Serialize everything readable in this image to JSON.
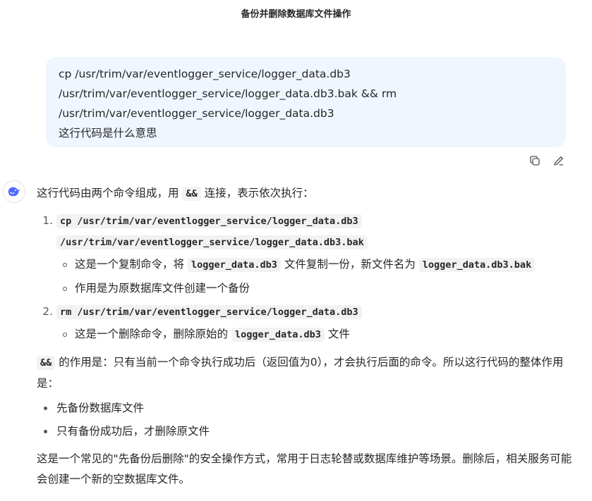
{
  "title": "备份并删除数据库文件操作",
  "user_message": {
    "lines": [
      "cp /usr/trim/var/eventlogger_service/logger_data.db3",
      "/usr/trim/var/eventlogger_service/logger_data.db3.bak && rm",
      "/usr/trim/var/eventlogger_service/logger_data.db3",
      "这行代码是什么意思"
    ]
  },
  "actions": {
    "copy_icon": "copy-icon",
    "edit_icon": "edit-icon"
  },
  "assistant_icon": "deepseek-whale-icon",
  "answer": {
    "intro_prefix": "这行代码由两个命令组成，用",
    "intro_code": "&&",
    "intro_suffix": "连接，表示依次执行：",
    "steps": [
      {
        "cmd_line1": "cp /usr/trim/var/eventlogger_service/logger_data.db3",
        "cmd_line2": "/usr/trim/var/eventlogger_service/logger_data.db3.bak",
        "sub1_prefix": "这是一个复制命令，将",
        "sub1_code1": "logger_data.db3",
        "sub1_mid": "文件复制一份，新文件名为",
        "sub1_code2": "logger_data.db3.bak",
        "sub2": "作用是为原数据库文件创建一个备份"
      },
      {
        "cmd_line1": "rm /usr/trim/var/eventlogger_service/logger_data.db3",
        "sub1_prefix": "这是一个删除命令，删除原始的",
        "sub1_code1": "logger_data.db3",
        "sub1_suffix": "文件"
      }
    ],
    "and_code": "&&",
    "and_text": "的作用是：只有当前一个命令执行成功后（返回值为0），才会执行后面的命令。所以这行代码的整体作用是：",
    "bullets": [
      "先备份数据库文件",
      "只有备份成功后，才删除原文件"
    ],
    "conclusion": "这是一个常见的\"先备份后删除\"的安全操作方式，常用于日志轮替或数据库维护等场景。删除后，相关服务可能会创建一个新的空数据库文件。"
  }
}
